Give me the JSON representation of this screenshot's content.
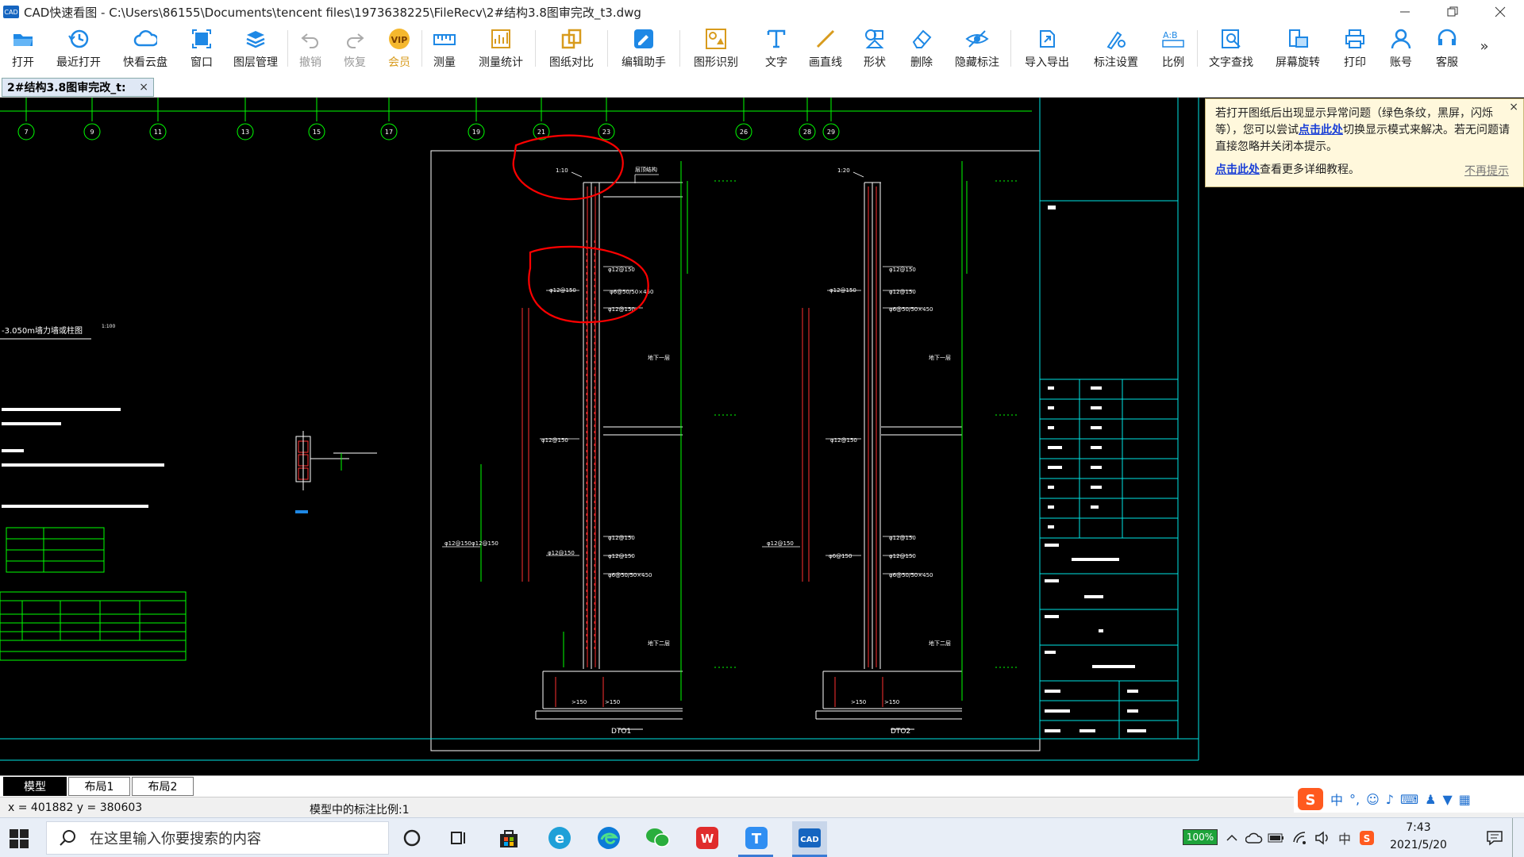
{
  "window": {
    "app_logo": "CAD",
    "title": "CAD快速看图 - C:\\Users\\86155\\Documents\\tencent files\\1973638225\\FileRecv\\2#结构3.8图审完改_t3.dwg"
  },
  "toolbar": {
    "items": [
      {
        "label": "打开",
        "icon": "folder-open-icon"
      },
      {
        "label": "最近打开",
        "icon": "history-icon"
      },
      {
        "label": "快看云盘",
        "icon": "cloud-icon"
      },
      {
        "label": "窗口",
        "icon": "window-icon"
      },
      {
        "label": "图层管理",
        "icon": "layers-icon"
      },
      {
        "label": "撤销",
        "icon": "undo-icon"
      },
      {
        "label": "恢复",
        "icon": "redo-icon"
      },
      {
        "label": "会员",
        "icon": "vip-icon"
      },
      {
        "label": "测量",
        "icon": "ruler-icon"
      },
      {
        "label": "测量统计",
        "icon": "measure-stats-icon"
      },
      {
        "label": "图纸对比",
        "icon": "compare-icon"
      },
      {
        "label": "编辑助手",
        "icon": "edit-assistant-icon"
      },
      {
        "label": "图形识别",
        "icon": "shape-recognize-icon"
      },
      {
        "label": "文字",
        "icon": "text-icon"
      },
      {
        "label": "画直线",
        "icon": "line-icon"
      },
      {
        "label": "形状",
        "icon": "shapes-icon"
      },
      {
        "label": "删除",
        "icon": "eraser-icon"
      },
      {
        "label": "隐藏标注",
        "icon": "hide-annotation-icon"
      },
      {
        "label": "导入导出",
        "icon": "import-export-icon"
      },
      {
        "label": "标注设置",
        "icon": "annotation-settings-icon"
      },
      {
        "label": "比例",
        "icon": "scale-icon"
      },
      {
        "label": "文字查找",
        "icon": "text-search-icon"
      },
      {
        "label": "屏幕旋转",
        "icon": "rotate-screen-icon"
      },
      {
        "label": "打印",
        "icon": "printer-icon"
      },
      {
        "label": "账号",
        "icon": "account-icon"
      },
      {
        "label": "客服",
        "icon": "headset-icon"
      }
    ],
    "vip_badge": "VIP",
    "overflow": "»"
  },
  "doc_tab": {
    "label": "2#结构3.8图审完改_t:",
    "close": "×"
  },
  "notice": {
    "text_part1": "若打开图纸后出现显示异常问题（绿色条纹，黑屏，闪烁等），您可以尝试",
    "link1": "点击此处",
    "text_part2": "切换显示模式来解决。若无问题请直接忽略并关闭本提示。",
    "link2": "点击此处",
    "text_part3": "查看更多详细教程。",
    "dismiss": "不再提示",
    "close": "×"
  },
  "drawing": {
    "axis_numbers": [
      "7",
      "9",
      "11",
      "13",
      "15",
      "17",
      "19",
      "21",
      "23",
      "26",
      "28",
      "29"
    ],
    "section_title": "-3.050m墙力墙或柱图",
    "section_scale": "1:100",
    "elevation_left_label": "DTO1",
    "elevation_right_label": "DTO2",
    "rebar_labels": [
      "φ12@150",
      "φ12@150",
      "φ6@50/50×450",
      "φ12@150",
      "φ12@150",
      "φ12@150",
      "φ6@50/50×450"
    ],
    "dim_labels": [
      ">150",
      ">150",
      ">150",
      ">150"
    ]
  },
  "layout_tabs": {
    "model": "模型",
    "layout1": "布局1",
    "layout2": "布局2"
  },
  "status": {
    "coords": "x = 401882  y = 380603",
    "scale": "模型中的标注比例:1"
  },
  "ime": {
    "lang": "中"
  },
  "taskbar": {
    "search_placeholder": "在这里输入你要搜索的内容",
    "battery": "100%",
    "tray_lang": "中",
    "time": "7:43",
    "date": "2021/5/20"
  },
  "colors": {
    "canvas_bg": "#000000",
    "cad_white": "#ffffff",
    "cad_green": "#00ff00",
    "cad_cyan": "#00e5e5",
    "cad_red": "#ff3030",
    "annotation_red": "#ff0000"
  }
}
